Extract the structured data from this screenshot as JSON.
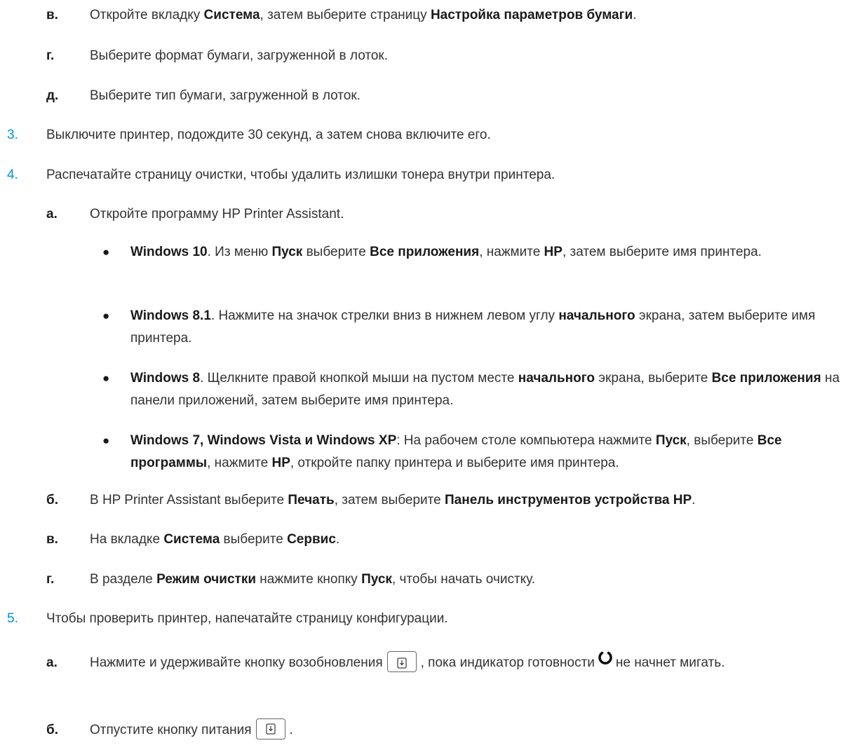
{
  "steps": {
    "c": {
      "marker": "в.",
      "t1": "Откройте вкладку ",
      "b1": "Система",
      "t2": ", затем выберите страницу ",
      "b2": "Настройка параметров бумаги",
      "t3": "."
    },
    "d": {
      "marker": "г.",
      "t1": "Выберите формат бумаги, загруженной в лоток."
    },
    "e": {
      "marker": "д.",
      "t1": "Выберите тип бумаги, загруженной в лоток."
    },
    "s3": {
      "marker": "3.",
      "t1": "Выключите принтер, подождите 30 секунд, а затем снова включите его."
    },
    "s4": {
      "marker": "4.",
      "t1": "Распечатайте страницу очистки, чтобы удалить излишки тонера внутри принтера."
    },
    "s4a": {
      "marker": "а.",
      "t1": "Откройте программу HP Printer Assistant."
    },
    "bul1": {
      "marker": "●",
      "b1": "Windows 10",
      "t1": ". Из меню ",
      "b2": "Пуск",
      "t2": " выберите ",
      "b3": "Все приложения",
      "t3": ", нажмите ",
      "b4": "HP",
      "t4": ", затем выберите имя принтера."
    },
    "bul2": {
      "marker": "●",
      "b1": "Windows 8.1",
      "t1": ". Нажмите на значок стрелки вниз в нижнем левом углу ",
      "b2": "начального",
      "t2": " экрана, затем выберите имя принтера."
    },
    "bul3": {
      "marker": "●",
      "b1": "Windows 8",
      "t1": ". Щелкните правой кнопкой мыши на пустом месте ",
      "b2": "начального",
      "t2": " экрана, выберите ",
      "b3": "Все приложения",
      "t3": " на панели приложений, затем выберите имя принтера."
    },
    "bul4": {
      "marker": "●",
      "b1": "Windows 7, Windows Vista и Windows XP",
      "t1": ": На рабочем столе компьютера нажмите ",
      "b2": "Пуск",
      "t2": ", выберите ",
      "b3": "Все программы",
      "t3": ", нажмите ",
      "b4": "HP",
      "t4": ", откройте папку принтера и выберите имя принтера."
    },
    "s4b": {
      "marker": "б.",
      "t1": "В HP Printer Assistant выберите ",
      "b1": "Печать",
      "t2": ", затем выберите ",
      "b2": "Панель инструментов устройства HP",
      "t3": "."
    },
    "s4c": {
      "marker": "в.",
      "t1": "На вкладке ",
      "b1": "Система",
      "t2": " выберите ",
      "b2": "Сервис",
      "t3": "."
    },
    "s4d": {
      "marker": "г.",
      "t1": "В разделе ",
      "b1": "Режим очистки",
      "t2": " нажмите кнопку ",
      "b2": "Пуск",
      "t3": ", чтобы начать очистку."
    },
    "s5": {
      "marker": "5.",
      "t1": "Чтобы проверить принтер, напечатайте страницу конфигурации."
    },
    "s5a": {
      "marker": "а.",
      "t1": "Нажмите и удерживайте кнопку возобновления",
      "t2": ", пока индикатор готовности",
      "t3": "не начнет мигать."
    },
    "s5b": {
      "marker": "б.",
      "t1": "Отпустите кнопку питания",
      "t2": "."
    }
  },
  "icons": {
    "resume_button": "resume-button-icon",
    "ready_light": "ready-light-icon"
  },
  "colors": {
    "step_number": "#0096d6",
    "text": "#333333",
    "bold": "#1a1a1a"
  }
}
